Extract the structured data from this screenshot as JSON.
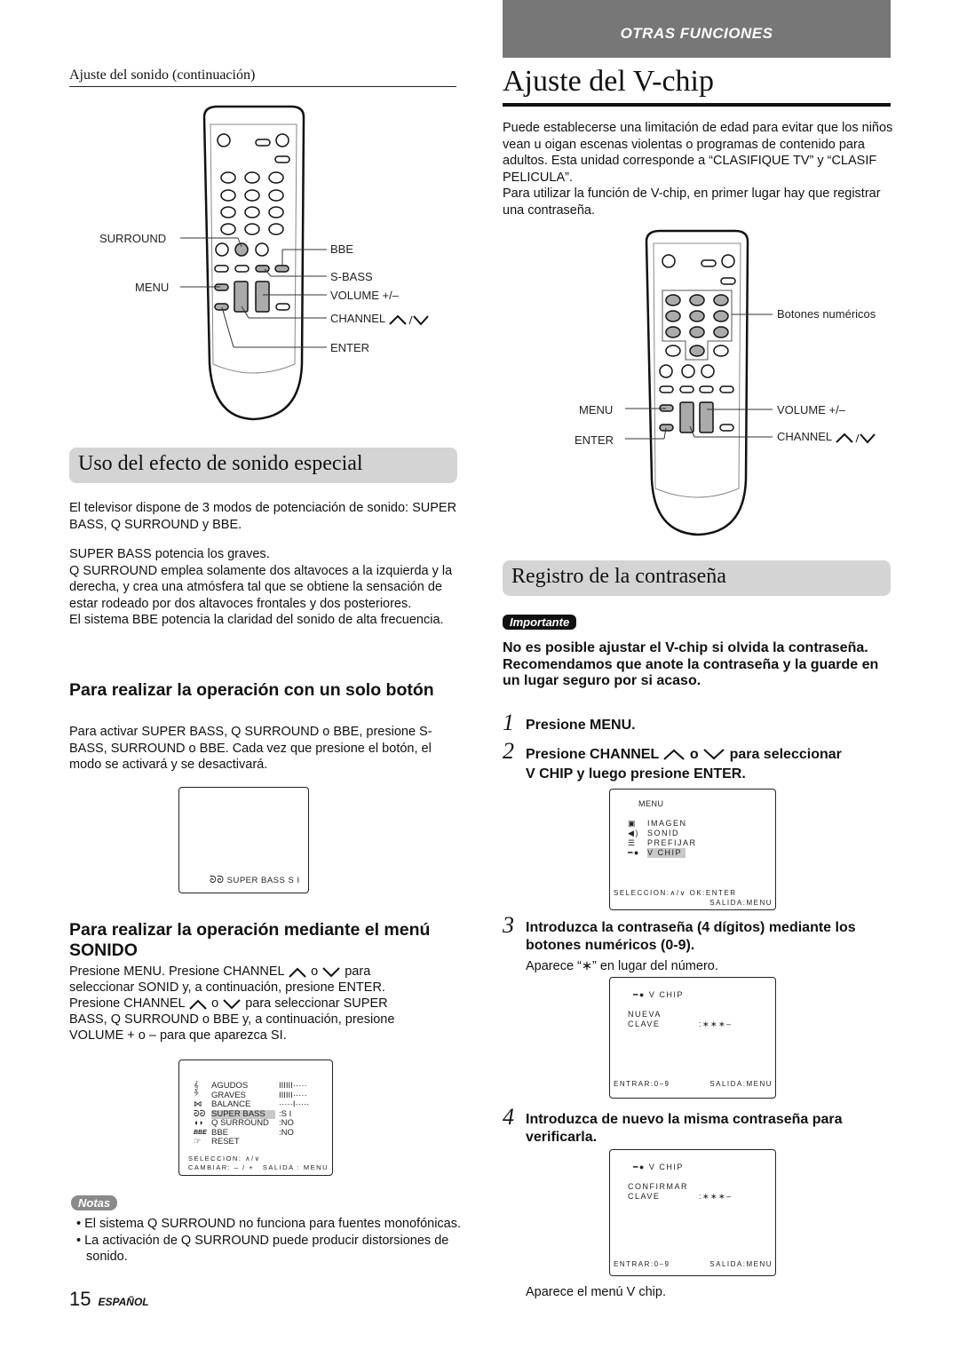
{
  "header": {
    "section_banner": "OTRAS FUNCIONES",
    "banner_color": "#777777"
  },
  "left": {
    "continuation_title": "Ajuste del sonido (continuación)",
    "remote_labels": {
      "surround": "SURROUND",
      "menu": "MENU",
      "bbe": "BBE",
      "sbass": "S-BASS",
      "volume": "VOLUME +/–",
      "channel": "CHANNEL",
      "enter": "ENTER"
    },
    "section_title": "Uso del efecto de sonido especial",
    "intro": "El televisor dispone de 3 modos de potenciación de sonido: SUPER BASS, Q SURROUND y BBE.",
    "paragraphs": [
      "SUPER BASS potencia los graves.",
      "Q SURROUND emplea solamente dos altavoces a la izquierda y la derecha, y crea una atmósfera tal que se obtiene la sensación de estar rodeado por dos altavoces frontales y dos posteriores.",
      "El sistema BBE potencia la claridad del sonido de alta frecuencia."
    ],
    "one_button": {
      "title": "Para realizar la operación con un solo botón",
      "body": "Para activar SUPER BASS, Q SURROUND o BBE, presione S-BASS, SURROUND o BBE.  Cada vez que presione el botón, el modo se activará y se desactivará."
    },
    "osd_superbass": "SUPER BASS S I",
    "menu_sonido": {
      "title": "Para realizar la operación mediante el menú SONIDO",
      "line1_a": "Presione MENU.  Presione CHANNEL",
      "line1_o": "o",
      "line1_b": "para",
      "line2": "seleccionar SONID y, a continuación, presione ENTER.",
      "line3_a": "Presione CHANNEL",
      "line3_o": "o",
      "line3_b": "para seleccionar SUPER",
      "line4": "BASS, Q SURROUND o BBE y, a continuación, presione",
      "line5": "VOLUME + o – para que aparezca SI."
    },
    "sound_menu_osd": {
      "items": [
        {
          "label": "AGUDOS",
          "value": "IIIIII·····",
          "icon": "treble-clef-icon"
        },
        {
          "label": "GRAVES",
          "value": "IIIIII·····",
          "icon": "bass-clef-icon"
        },
        {
          "label": "BALANCE",
          "value": "·····I·····",
          "icon": "balance-icon"
        },
        {
          "label": "SUPER BASS",
          "value": ":S I",
          "icon": "super-bass-icon",
          "selected": true
        },
        {
          "label": "Q SURROUND",
          "value": ":NO",
          "icon": "surround-icon"
        },
        {
          "label": "BBE",
          "value": ":NO",
          "icon": "bbe-icon"
        },
        {
          "label": "RESET",
          "value": "",
          "icon": "reset-icon"
        }
      ],
      "footer1": "SELECCION: ∧/∨",
      "footer2_a": "CAMBIAR: – / +",
      "footer2_b": "SALIDA : MENU"
    },
    "notes_badge": "Notas",
    "notes": [
      "El sistema Q SURROUND no funciona para fuentes monofónicas.",
      "La activación de Q SURROUND puede producir distorsiones de sonido."
    ],
    "page_number": "15",
    "language": "ESPAÑOL"
  },
  "right": {
    "title": "Ajuste del V-chip",
    "intro1": "Puede establecerse una limitación de edad para evitar que los niños vean u oigan escenas violentas o programas de contenido para adultos. Esta unidad corresponde a “CLASIFIQUE TV” y “CLASIF PELICULA”.",
    "intro2": "Para utilizar la función de V-chip, en primer lugar hay que registrar una contraseña.",
    "remote_labels": {
      "numeric": "Botones numéricos",
      "menu": "MENU",
      "enter": "ENTER",
      "volume": "VOLUME +/–",
      "channel": "CHANNEL"
    },
    "section_title": "Registro de la contraseña",
    "important_badge": "Importante",
    "important_text": "No es posible ajustar el V-chip si olvida la contraseña. Recomendamos que anote la contraseña y la guarde en un lugar seguro por si acaso.",
    "steps": [
      {
        "num": "1",
        "text": "Presione MENU."
      },
      {
        "num": "2",
        "text_a": "Presione CHANNEL",
        "text_o": "o",
        "text_b": "para seleccionar",
        "text_c": "V CHIP y luego presione ENTER."
      },
      {
        "num": "3",
        "text": "Introduzca la contraseña (4 dígitos) mediante los botones numéricos (0-9).",
        "sub": "Aparece “∗”  en lugar del número."
      },
      {
        "num": "4",
        "text": "Introduzca de nuevo la misma contraseña para verificarla.",
        "sub": "Aparece el menú V chip."
      }
    ],
    "main_menu_osd": {
      "title": "MENU",
      "items": [
        {
          "label": "IMAGEN",
          "icon": "picture-icon"
        },
        {
          "label": "SONID",
          "icon": "speaker-icon"
        },
        {
          "label": "PREFIJAR",
          "icon": "preset-icon"
        },
        {
          "label": "V CHIP",
          "icon": "key-icon",
          "selected": true
        }
      ],
      "footer1": "SELECCION:∧/∨ OK:ENTER",
      "footer2": "SALIDA:MENU"
    },
    "new_password_osd": {
      "title": "V CHIP",
      "line1": "NUEVA",
      "line2": "CLAVE",
      "value": ":∗∗∗–",
      "footer_a": "ENTRAR:0–9",
      "footer_b": "SALIDA:MENU"
    },
    "confirm_password_osd": {
      "title": "V CHIP",
      "line1": "CONFIRMAR",
      "line2": "CLAVE",
      "value": ":∗∗∗–",
      "footer_a": "ENTRAR:0–9",
      "footer_b": "SALIDA:MENU"
    }
  }
}
